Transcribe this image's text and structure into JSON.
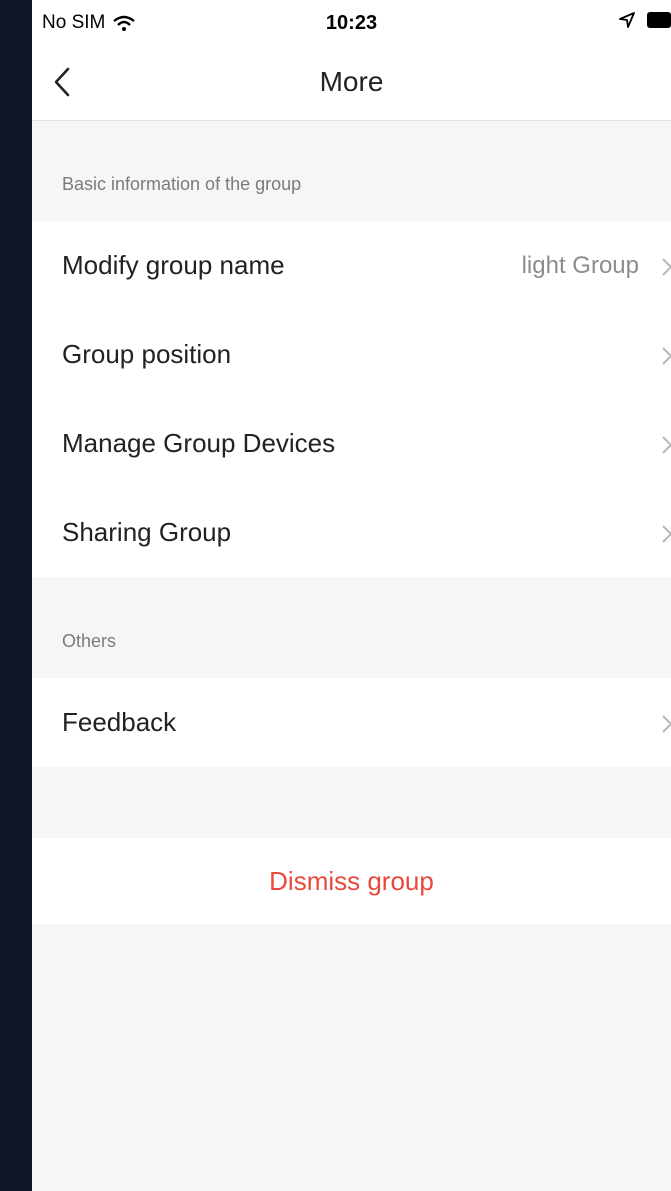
{
  "status_bar": {
    "carrier": "No SIM",
    "time": "10:23"
  },
  "nav": {
    "title": "More"
  },
  "sections": [
    {
      "header": "Basic information of the group",
      "items": [
        {
          "label": "Modify group name",
          "value": "light Group"
        },
        {
          "label": "Group position",
          "value": ""
        },
        {
          "label": "Manage Group Devices",
          "value": ""
        },
        {
          "label": "Sharing Group",
          "value": ""
        }
      ]
    },
    {
      "header": "Others",
      "items": [
        {
          "label": "Feedback",
          "value": ""
        }
      ]
    }
  ],
  "dismiss": {
    "label": "Dismiss group"
  },
  "colors": {
    "danger": "#e8493c",
    "background": "#f6f6f6",
    "frame": "#0e1628"
  },
  "icons": [
    "wifi-icon",
    "location-arrow-icon",
    "battery-icon",
    "back-chevron-icon",
    "chevron-right-icon"
  ]
}
